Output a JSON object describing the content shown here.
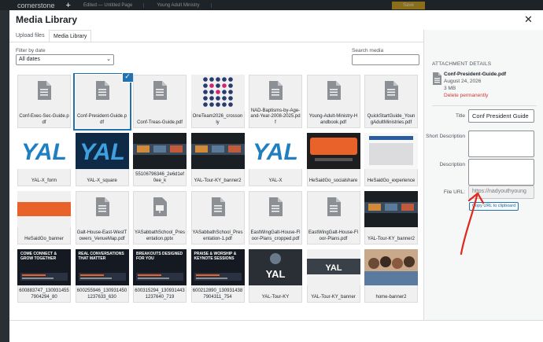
{
  "appbar": {
    "brand": "cornerstone",
    "tab_edited": "Edited — Untitled Page",
    "tab_yam": "Young Adult Ministry",
    "save_label": "Save"
  },
  "modal": {
    "title": "Media Library",
    "close_glyph": "✕"
  },
  "tabs": [
    {
      "label": "Upload files"
    },
    {
      "label": "Media Library"
    }
  ],
  "filter": {
    "label": "Filter by date",
    "value": "All dates"
  },
  "search": {
    "label": "Search media",
    "placeholder": ""
  },
  "tiles": [
    {
      "name": "Conf-Exec-Sec-Guide.pdf",
      "kind": "doc"
    },
    {
      "name": "Conf-President-Guide.pdf",
      "kind": "doc",
      "selected": true
    },
    {
      "name": "Conf-Treas-Guide.pdf",
      "kind": "doc"
    },
    {
      "name": "OneTeam2026_crossonly",
      "kind": "dots"
    },
    {
      "name": "NAD-Baptisms-by-Age-and-Year-2008-2025.pdf",
      "kind": "doc"
    },
    {
      "name": "Young-Adult-Ministry-Handbook.pdf",
      "kind": "doc"
    },
    {
      "name": "QuickStartGuide_YoungAdultMinistries.pdf",
      "kind": "doc"
    },
    {
      "name": "YAL-X_form",
      "kind": "yal-white"
    },
    {
      "name": "YAL-X_square",
      "kind": "yal-dark"
    },
    {
      "name": "55106796346_2e6d1ef0ee_k",
      "kind": "photo-dark"
    },
    {
      "name": "YAL-Tour-KY_banner2",
      "kind": "photo-dark"
    },
    {
      "name": "YAL-X",
      "kind": "yal-white"
    },
    {
      "name": "HeSaidGo_socialshare",
      "kind": "orange"
    },
    {
      "name": "HeSaidGo_experience",
      "kind": "exp"
    },
    {
      "name": "HeSaidGo_banner",
      "kind": "orange-banner"
    },
    {
      "name": "Galt-House-East-WestTowers_VenueMap.pdf",
      "kind": "doc"
    },
    {
      "name": "YASabbathSchool_Presentation.pptx",
      "kind": "slide"
    },
    {
      "name": "YASabbathSchool_Presentation-1.pdf",
      "kind": "doc"
    },
    {
      "name": "EastWingGalt-House-Floor-Plans_cropped.pdf",
      "kind": "doc"
    },
    {
      "name": "EastWingGalt-House-Floor-Plans.pdf",
      "kind": "doc"
    },
    {
      "name": "YAL-Tour-KY_banner2",
      "kind": "photo-dark"
    },
    {
      "name": "600883747_1309314557904294_80",
      "kind": "promo",
      "text": "COME CONNECT & GROW TOGETHER"
    },
    {
      "name": "600255946_1309314501237633_630",
      "kind": "promo",
      "text": "REAL CONVERSATIONS THAT MATTER"
    },
    {
      "name": "600315294_1309314431237640_719",
      "kind": "promo",
      "text": "BREAKOUTS DESIGNED FOR YOU"
    },
    {
      "name": "600212890_1309314387904311_754",
      "kind": "promo",
      "text": "PRAISE & WORSHIP & KEYNOTE SESSIONS"
    },
    {
      "name": "YAL-Tour-KY",
      "kind": "young-adult"
    },
    {
      "name": "YAL-Tour-KY_banner",
      "kind": "ya-banner"
    },
    {
      "name": "home-banner2",
      "kind": "people"
    }
  ],
  "sidebar": {
    "heading": "ATTACHMENT DETAILS",
    "file_name": "Conf-President-Guide.pdf",
    "date": "August 24, 2026",
    "size": "3 MB",
    "delete_label": "Delete permanently",
    "title_label": "Title",
    "title_value": "Conf President Guide",
    "short_desc_label": "Short Description",
    "desc_label": "Description",
    "url_label": "File URL:",
    "url_value": "https://nadyouthyoung",
    "copy_label": "Copy URL to clipboard"
  },
  "colors": {
    "accent": "#2271b1",
    "danger": "#d63638",
    "annotation": "#e0281b",
    "yal_blue": "#1f7fc1",
    "orange": "#e8622a"
  }
}
